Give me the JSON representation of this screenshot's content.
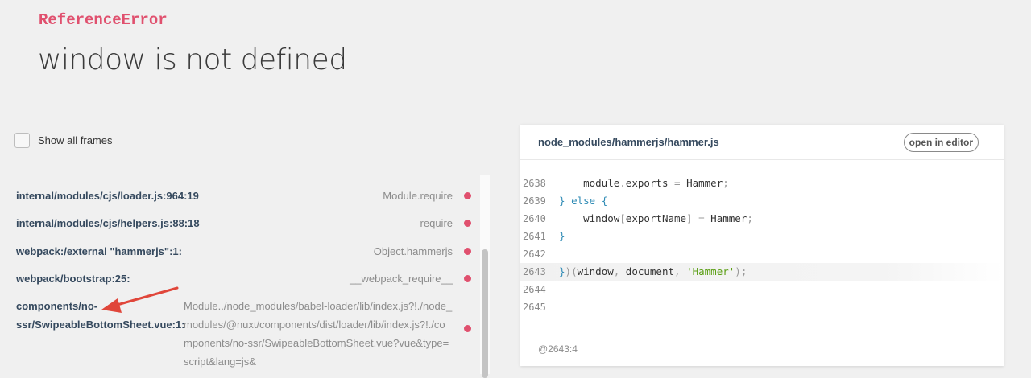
{
  "error": {
    "type": "ReferenceError",
    "message": "window is not defined"
  },
  "toggle": {
    "label": "Show all frames"
  },
  "frames": [
    {
      "file": "internal/modules/cjs/loader.js:964:19",
      "method": "Module.require"
    },
    {
      "file": "internal/modules/cjs/helpers.js:88:18",
      "method": "require"
    },
    {
      "file": "webpack:/external \"hammerjs\":1:",
      "method": "Object.hammerjs"
    },
    {
      "file": "webpack/bootstrap:25:",
      "method": "__webpack_require__"
    },
    {
      "file": "components/no-ssr/SwipeableBottomSheet.vue:1:",
      "method": "Module../node_modules/babel-loader/lib/index.js?!./node_modules/@nuxt/components/dist/loader/lib/index.js?!./components/no-ssr/SwipeableBottomSheet.vue?vue&type=script&lang=js&"
    }
  ],
  "source": {
    "file": "node_modules/hammerjs/hammer.js",
    "open_label": "open in editor",
    "location": "@2643:4",
    "lines": [
      {
        "n": "2638",
        "code": "    module.exports = Hammer;"
      },
      {
        "n": "2639",
        "code": "} else {"
      },
      {
        "n": "2640",
        "code": "    window[exportName] = Hammer;"
      },
      {
        "n": "2641",
        "code": "}"
      },
      {
        "n": "2642",
        "code": ""
      },
      {
        "n": "2643",
        "code": "})(window, document, 'Hammer');",
        "highlight": true
      },
      {
        "n": "2644",
        "code": ""
      },
      {
        "n": "2645",
        "code": ""
      }
    ]
  },
  "colors": {
    "accent": "#e0506e",
    "link": "#35495e",
    "annotation": "#e0463a"
  }
}
